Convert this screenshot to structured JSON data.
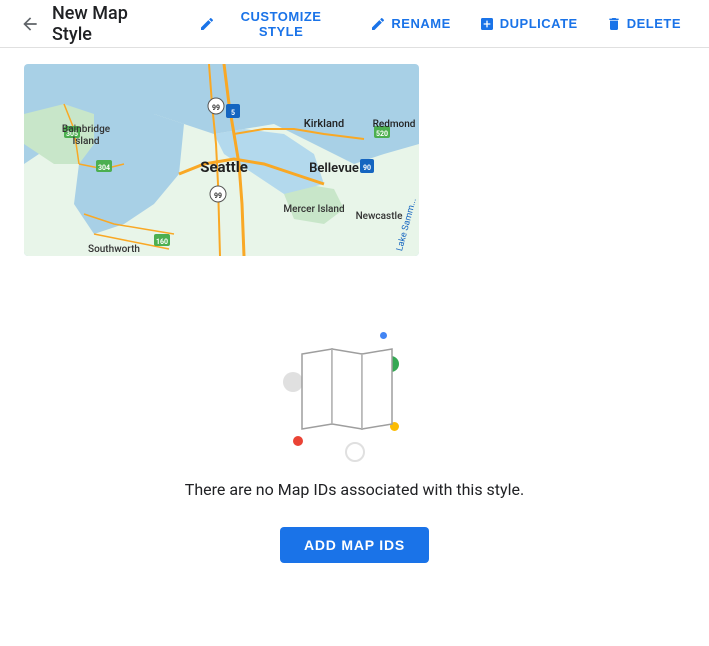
{
  "header": {
    "back_icon": "arrow-back",
    "title": "New Map Style",
    "actions": [
      {
        "id": "customize",
        "label": "CUSTOMIZE STYLE",
        "icon": "pencil-icon"
      },
      {
        "id": "rename",
        "label": "RENAME",
        "icon": "pencil-icon"
      },
      {
        "id": "duplicate",
        "label": "DUPLICATE",
        "icon": "duplicate-icon"
      },
      {
        "id": "delete",
        "label": "DELETE",
        "icon": "trash-icon"
      }
    ]
  },
  "empty_state": {
    "message": "There are no Map IDs associated with this style.",
    "cta_label": "ADD MAP IDS"
  },
  "colors": {
    "blue": "#1a73e8",
    "green": "#34a853",
    "red": "#ea4335",
    "yellow": "#fbbc04",
    "light_blue_dot": "#4285f4",
    "light_gray": "#e0e0e0"
  }
}
